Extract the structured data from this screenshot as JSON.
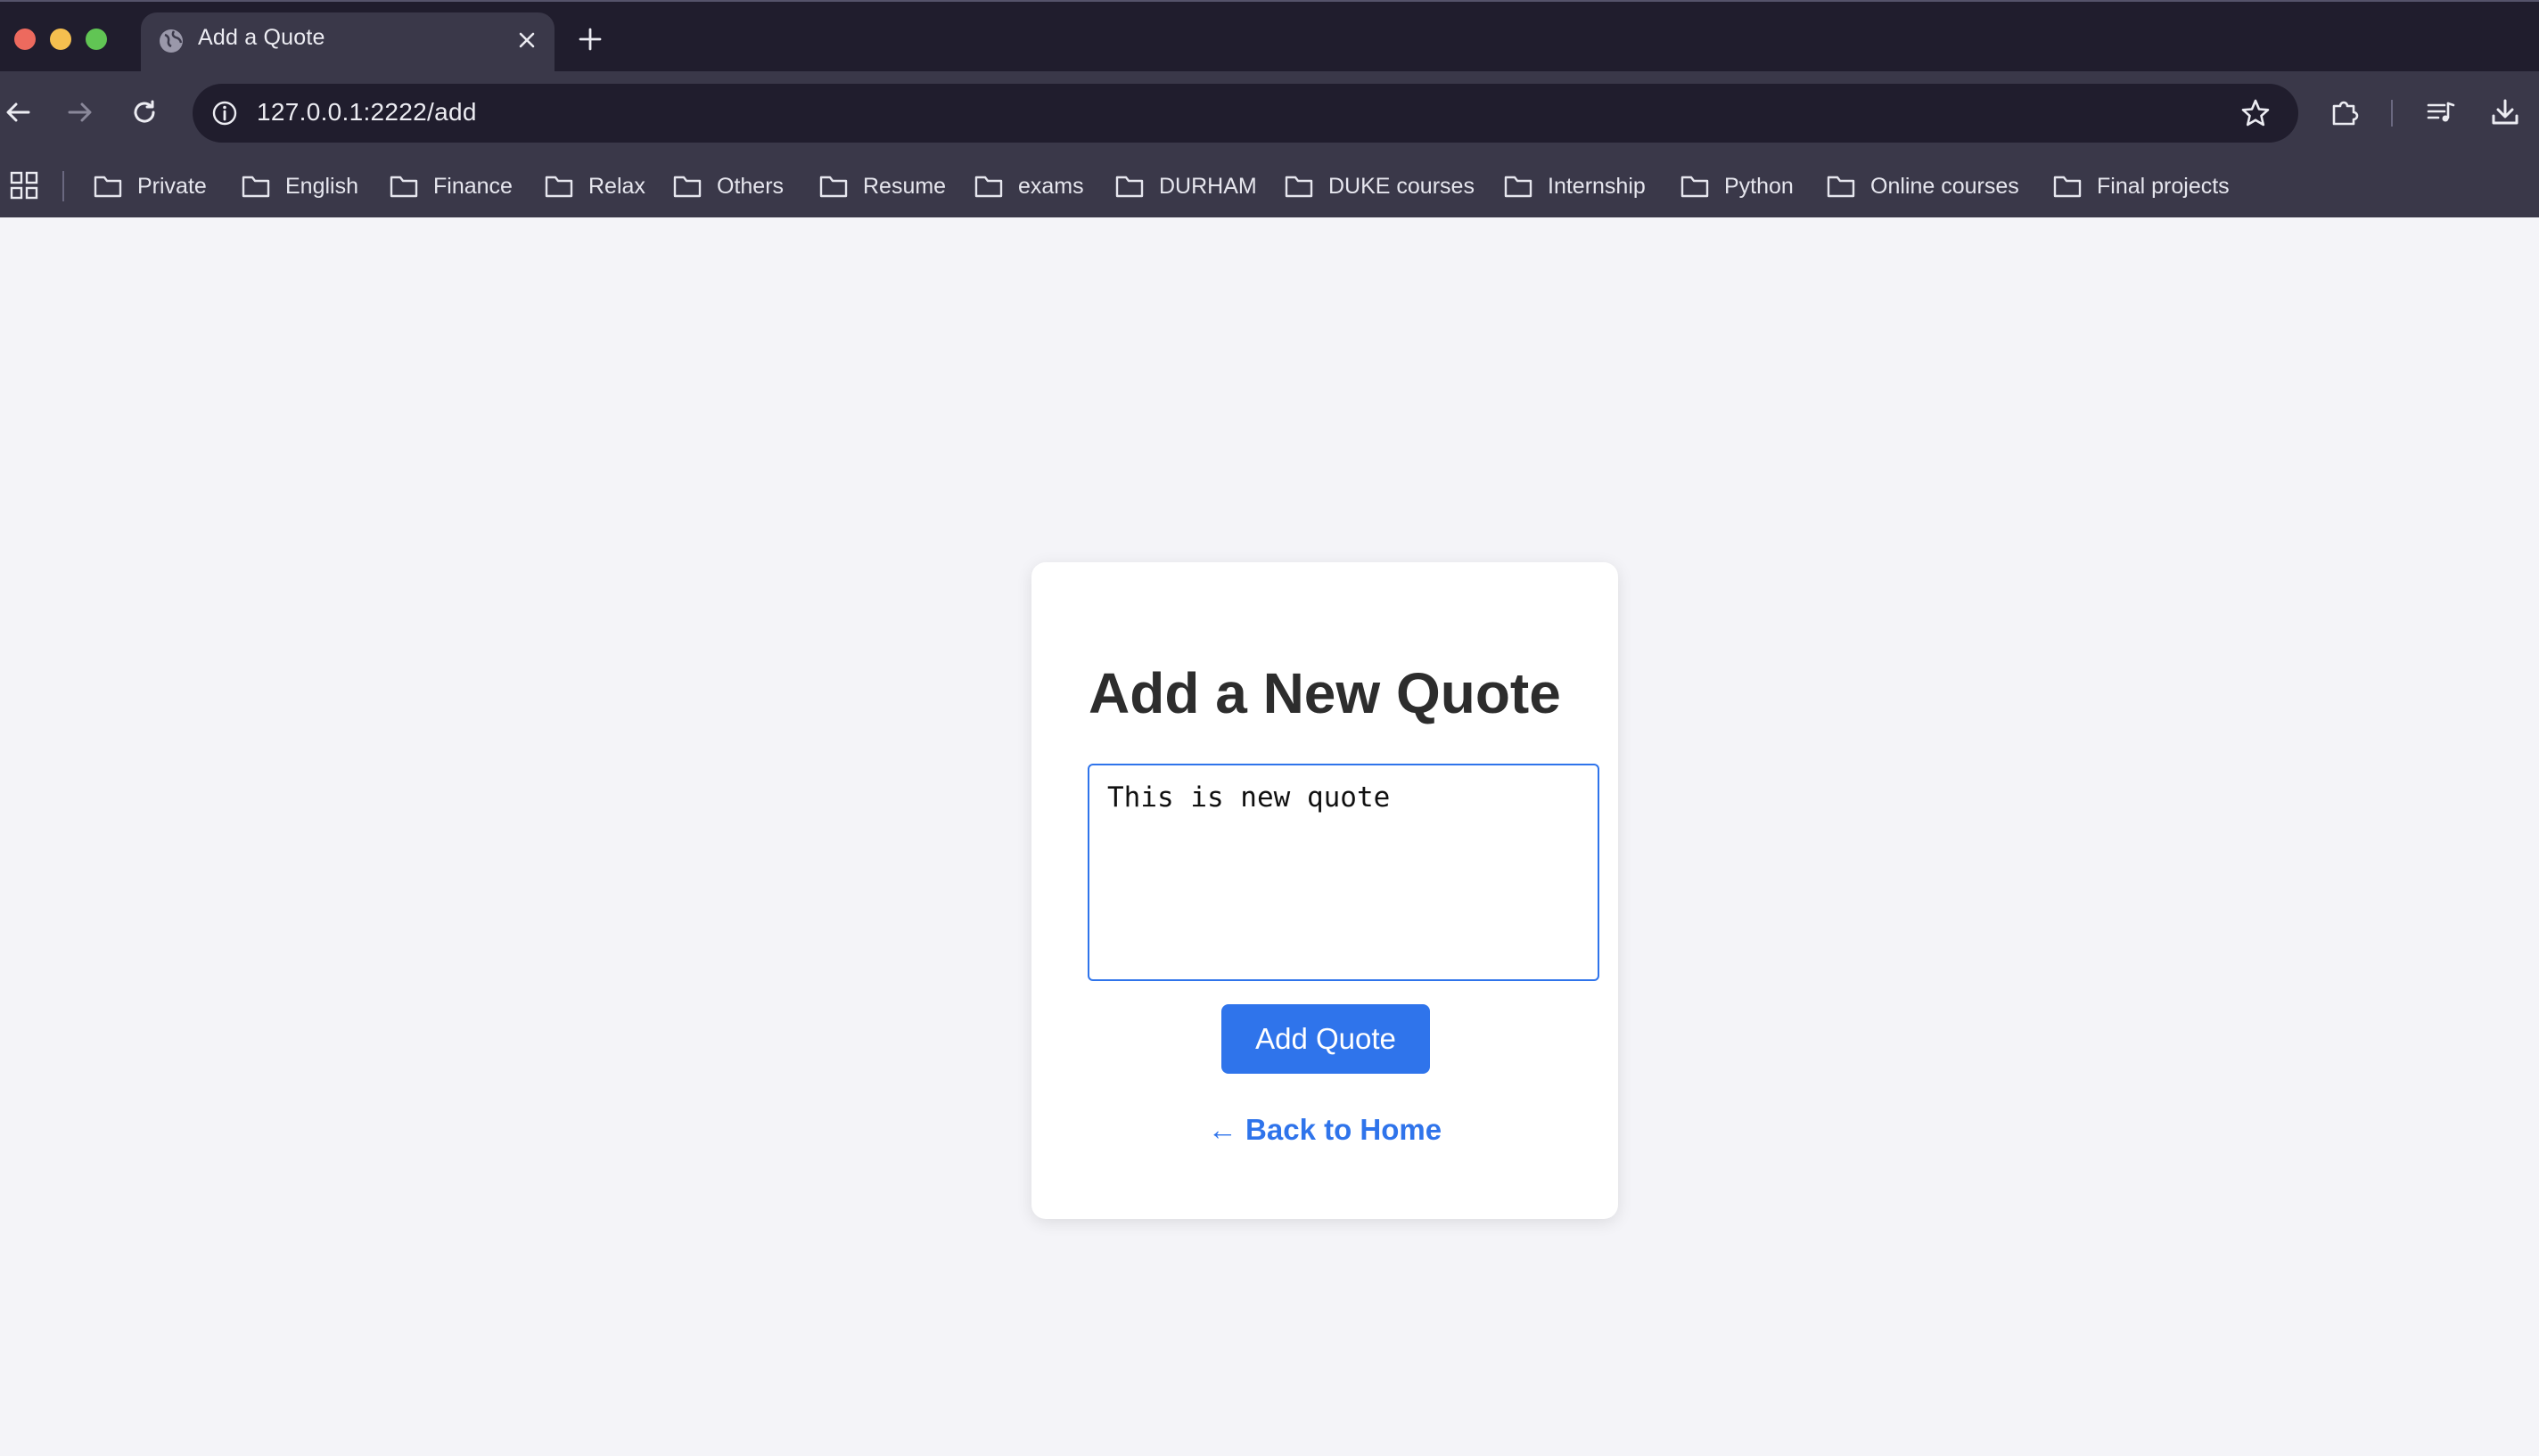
{
  "browser": {
    "tab_title": "Add a Quote",
    "url": "127.0.0.1:2222/add",
    "bookmarks": [
      "Private",
      "English",
      "Finance",
      "Relax",
      "Others",
      "Resume",
      "exams",
      "DURHAM",
      "DUKE courses",
      "Internship",
      "Python",
      "Online courses",
      "Final projects"
    ]
  },
  "page": {
    "title": "Add a New Quote",
    "quote_value": "This is new quote",
    "submit_label": "Add Quote",
    "back_link_label": "← Back to Home"
  },
  "colors": {
    "accent": "#2f74eb",
    "chrome_dark": "#201d2d",
    "chrome_mid": "#3a3849",
    "page_bg": "#f4f4f8"
  }
}
